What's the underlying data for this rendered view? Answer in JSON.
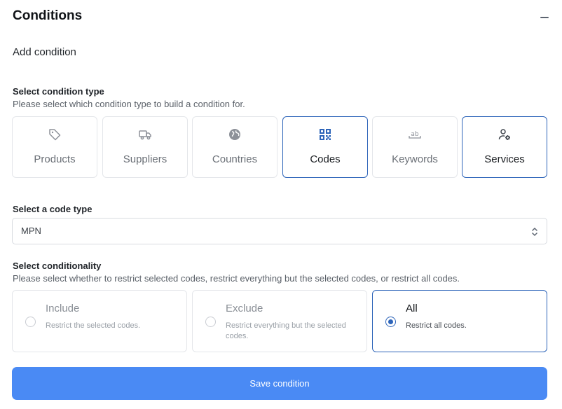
{
  "header": {
    "title": "Conditions",
    "collapse_icon": "minus-icon"
  },
  "add_condition": {
    "title": "Add condition"
  },
  "condition_type": {
    "label": "Select condition type",
    "help": "Please select which condition type to build a condition for.",
    "options": [
      {
        "label": "Products",
        "icon": "tag-icon",
        "selected": false
      },
      {
        "label": "Suppliers",
        "icon": "truck-icon",
        "selected": false
      },
      {
        "label": "Countries",
        "icon": "globe-icon",
        "selected": false
      },
      {
        "label": "Codes",
        "icon": "qr-code-icon",
        "selected": true
      },
      {
        "label": "Keywords",
        "icon": "text-ab-icon",
        "selected": false
      },
      {
        "label": "Services",
        "icon": "user-gear-icon",
        "selected": true
      }
    ]
  },
  "code_type": {
    "label": "Select a code type",
    "value": "MPN",
    "icon": "chevron-up-down-icon"
  },
  "conditionality": {
    "label": "Select conditionality",
    "help": "Please select whether to restrict selected codes, restrict everything but the selected codes, or restrict all codes.",
    "options": [
      {
        "title": "Include",
        "description": "Restrict the selected codes.",
        "selected": false
      },
      {
        "title": "Exclude",
        "description": "Restrict everything but the selected codes.",
        "selected": false
      },
      {
        "title": "All",
        "description": "Restrict all codes.",
        "selected": true
      }
    ]
  },
  "save_button": {
    "label": "Save condition"
  },
  "colors": {
    "accent": "#2d64b9",
    "button": "#4a8af4",
    "muted_text": "#6b7077",
    "border": "#e4e6ea"
  }
}
